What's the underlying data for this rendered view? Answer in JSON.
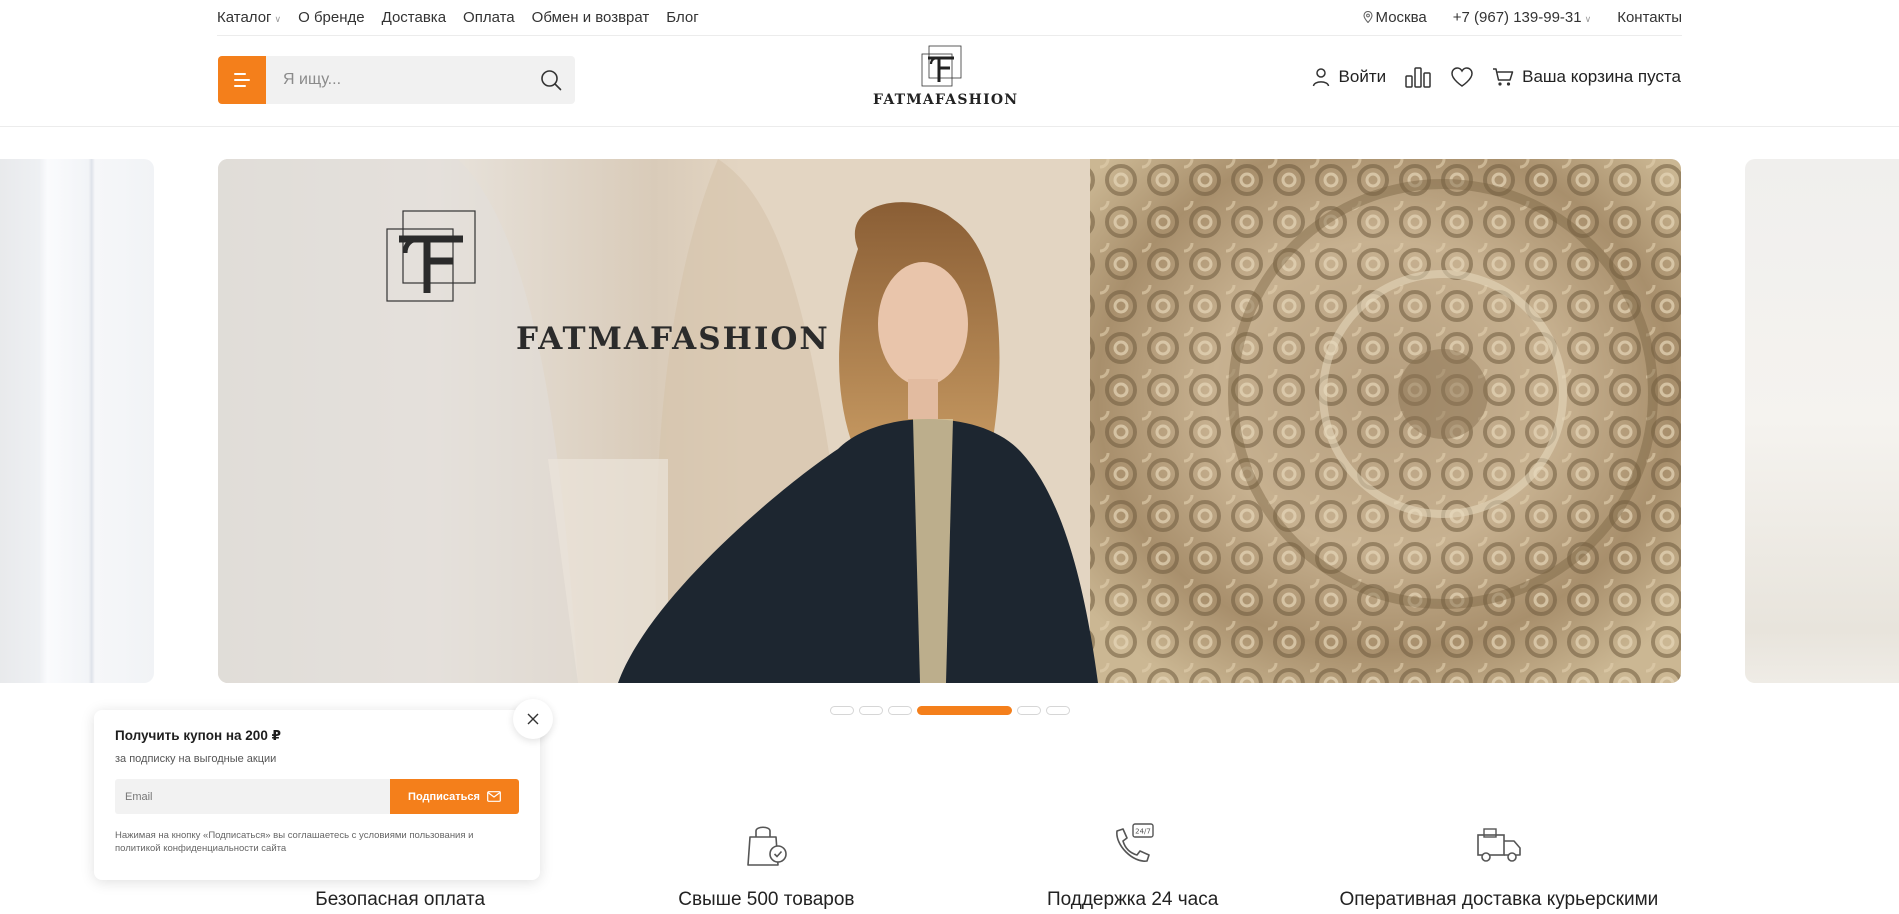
{
  "topbar": {
    "nav": [
      {
        "label": "Каталог",
        "has_dropdown": true
      },
      {
        "label": "О бренде"
      },
      {
        "label": "Доставка"
      },
      {
        "label": "Оплата"
      },
      {
        "label": "Обмен и возврат"
      },
      {
        "label": "Блог"
      }
    ],
    "city": "Москва",
    "phone": "+7 (967) 139-99-31",
    "contacts": "Контакты"
  },
  "header": {
    "search_placeholder": "Я ищу...",
    "logo_text": "FATMAFASHION",
    "login_label": "Войти",
    "cart_label": "Ваша корзина пуста"
  },
  "slider": {
    "banner_logo_text": "FATMAFASHION",
    "dots_count": 6,
    "active_dot": 3
  },
  "features": [
    {
      "icon": "shield-check-icon",
      "title": "Безопасная оплата"
    },
    {
      "icon": "shopping-bag-icon",
      "title": "Свыше 500 товаров"
    },
    {
      "icon": "phone-24-7-icon",
      "title": "Поддержка 24 часа"
    },
    {
      "icon": "delivery-truck-icon",
      "title": "Оперативная доставка курьерскими"
    }
  ],
  "popup": {
    "title": "Получить купон на 200 ₽",
    "subtitle": "за подписку на выгодные акции",
    "email_placeholder": "Email",
    "subscribe_label": "Подписаться",
    "note": "Нажимая на кнопку «Подписаться» вы соглашаетесь с условиями пользования и политикой конфиденциальности сайта"
  },
  "colors": {
    "accent": "#f47f1b",
    "text": "#222222",
    "border": "#ececec"
  }
}
